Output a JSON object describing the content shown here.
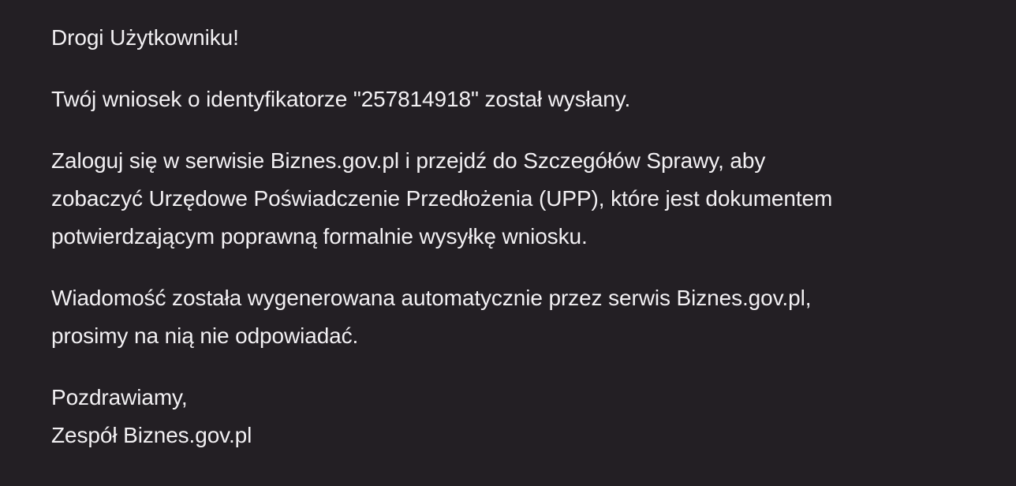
{
  "email": {
    "greeting": "Drogi Użytkowniku!",
    "submission_line": "Twój wniosek o identyfikatorze \"257814918\" został wysłany.",
    "instructions_lines": [
      "Zaloguj się w serwisie Biznes.gov.pl i przejdź do Szczegółów Sprawy, aby",
      "zobaczyć Urzędowe Poświadczenie Przedłożenia (UPP), które jest dokumentem",
      "potwierdzającym poprawną formalnie wysyłkę wniosku."
    ],
    "auto_notice_lines": [
      "Wiadomość została wygenerowana automatycznie przez serwis Biznes.gov.pl,",
      "prosimy na nią nie odpowiadać."
    ],
    "closing": "Pozdrawiamy,",
    "signature": "Zespół Biznes.gov.pl"
  },
  "colors": {
    "background": "#231f24",
    "text": "#f2f0f3"
  }
}
